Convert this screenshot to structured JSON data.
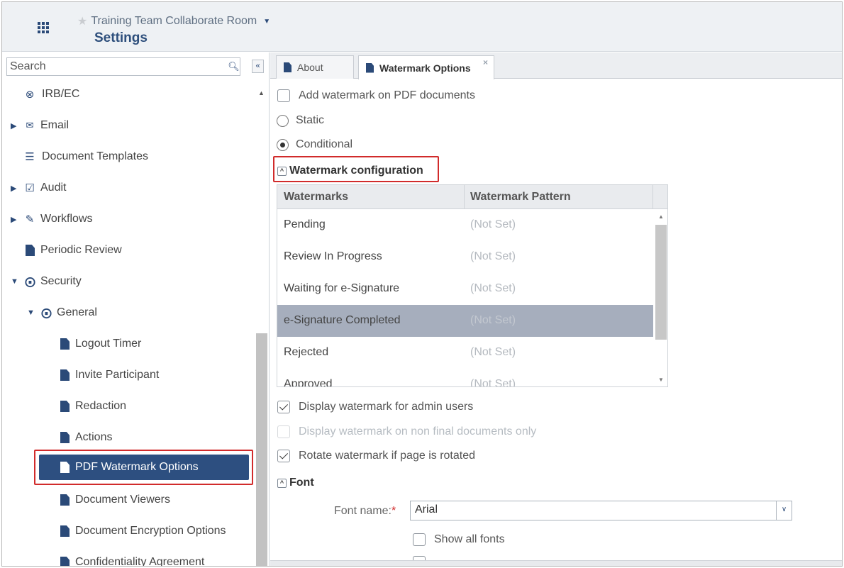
{
  "header": {
    "room_title": "Training Team Collaborate Room",
    "page_title": "Settings"
  },
  "sidebar": {
    "search_placeholder": "Search",
    "items": [
      {
        "label": "IRB/EC",
        "icon": "check-circle-icon"
      },
      {
        "label": "Email",
        "icon": "envelope-icon"
      },
      {
        "label": "Document Templates",
        "icon": "list-icon"
      },
      {
        "label": "Audit",
        "icon": "audit-icon"
      },
      {
        "label": "Workflows",
        "icon": "pencil-icon"
      },
      {
        "label": "Periodic Review",
        "icon": "document-icon"
      },
      {
        "label": "Security",
        "icon": "keys-icon"
      },
      {
        "label": "General",
        "icon": "keys-icon"
      },
      {
        "label": "Logout Timer",
        "icon": "document-icon"
      },
      {
        "label": "Invite Participant",
        "icon": "document-icon"
      },
      {
        "label": "Redaction",
        "icon": "document-icon"
      },
      {
        "label": "Actions",
        "icon": "document-icon"
      },
      {
        "label": "PDF Watermark Options",
        "icon": "document-icon",
        "selected": true
      },
      {
        "label": "Document Viewers",
        "icon": "document-icon"
      },
      {
        "label": "Document Encryption Options",
        "icon": "document-icon"
      },
      {
        "label": "Confidentiality Agreement",
        "icon": "document-icon"
      }
    ]
  },
  "tabs": [
    {
      "label": "About"
    },
    {
      "label": "Watermark Options",
      "active": true,
      "close": "×"
    }
  ],
  "options": {
    "add_watermark_label": "Add watermark on PDF documents",
    "static_label": "Static",
    "conditional_label": "Conditional",
    "watermark_config_label": "Watermark configuration",
    "display_admin_label": "Display watermark for admin users",
    "display_nonfinal_label": "Display watermark on non final documents only",
    "rotate_label": "Rotate watermark if page is rotated",
    "font_section_label": "Font",
    "font_name_label": "Font name:",
    "font_required": "*",
    "font_value": "Arial",
    "show_all_fonts_label": "Show all fonts"
  },
  "grid": {
    "columns": [
      "Watermarks",
      "Watermark Pattern"
    ],
    "rows": [
      {
        "name": "Pending",
        "pattern": "(Not Set)"
      },
      {
        "name": "Review In Progress",
        "pattern": "(Not Set)"
      },
      {
        "name": "Waiting for e-Signature",
        "pattern": "(Not Set)"
      },
      {
        "name": "e-Signature Completed",
        "pattern": "(Not Set)",
        "selected": true
      },
      {
        "name": "Rejected",
        "pattern": "(Not Set)"
      },
      {
        "name": "Approved",
        "pattern": "(Not Set)"
      }
    ]
  },
  "colors": {
    "accent": "#2d4f80",
    "highlight_outline": "#d12b2b",
    "selected_row": "#a6aebd"
  }
}
